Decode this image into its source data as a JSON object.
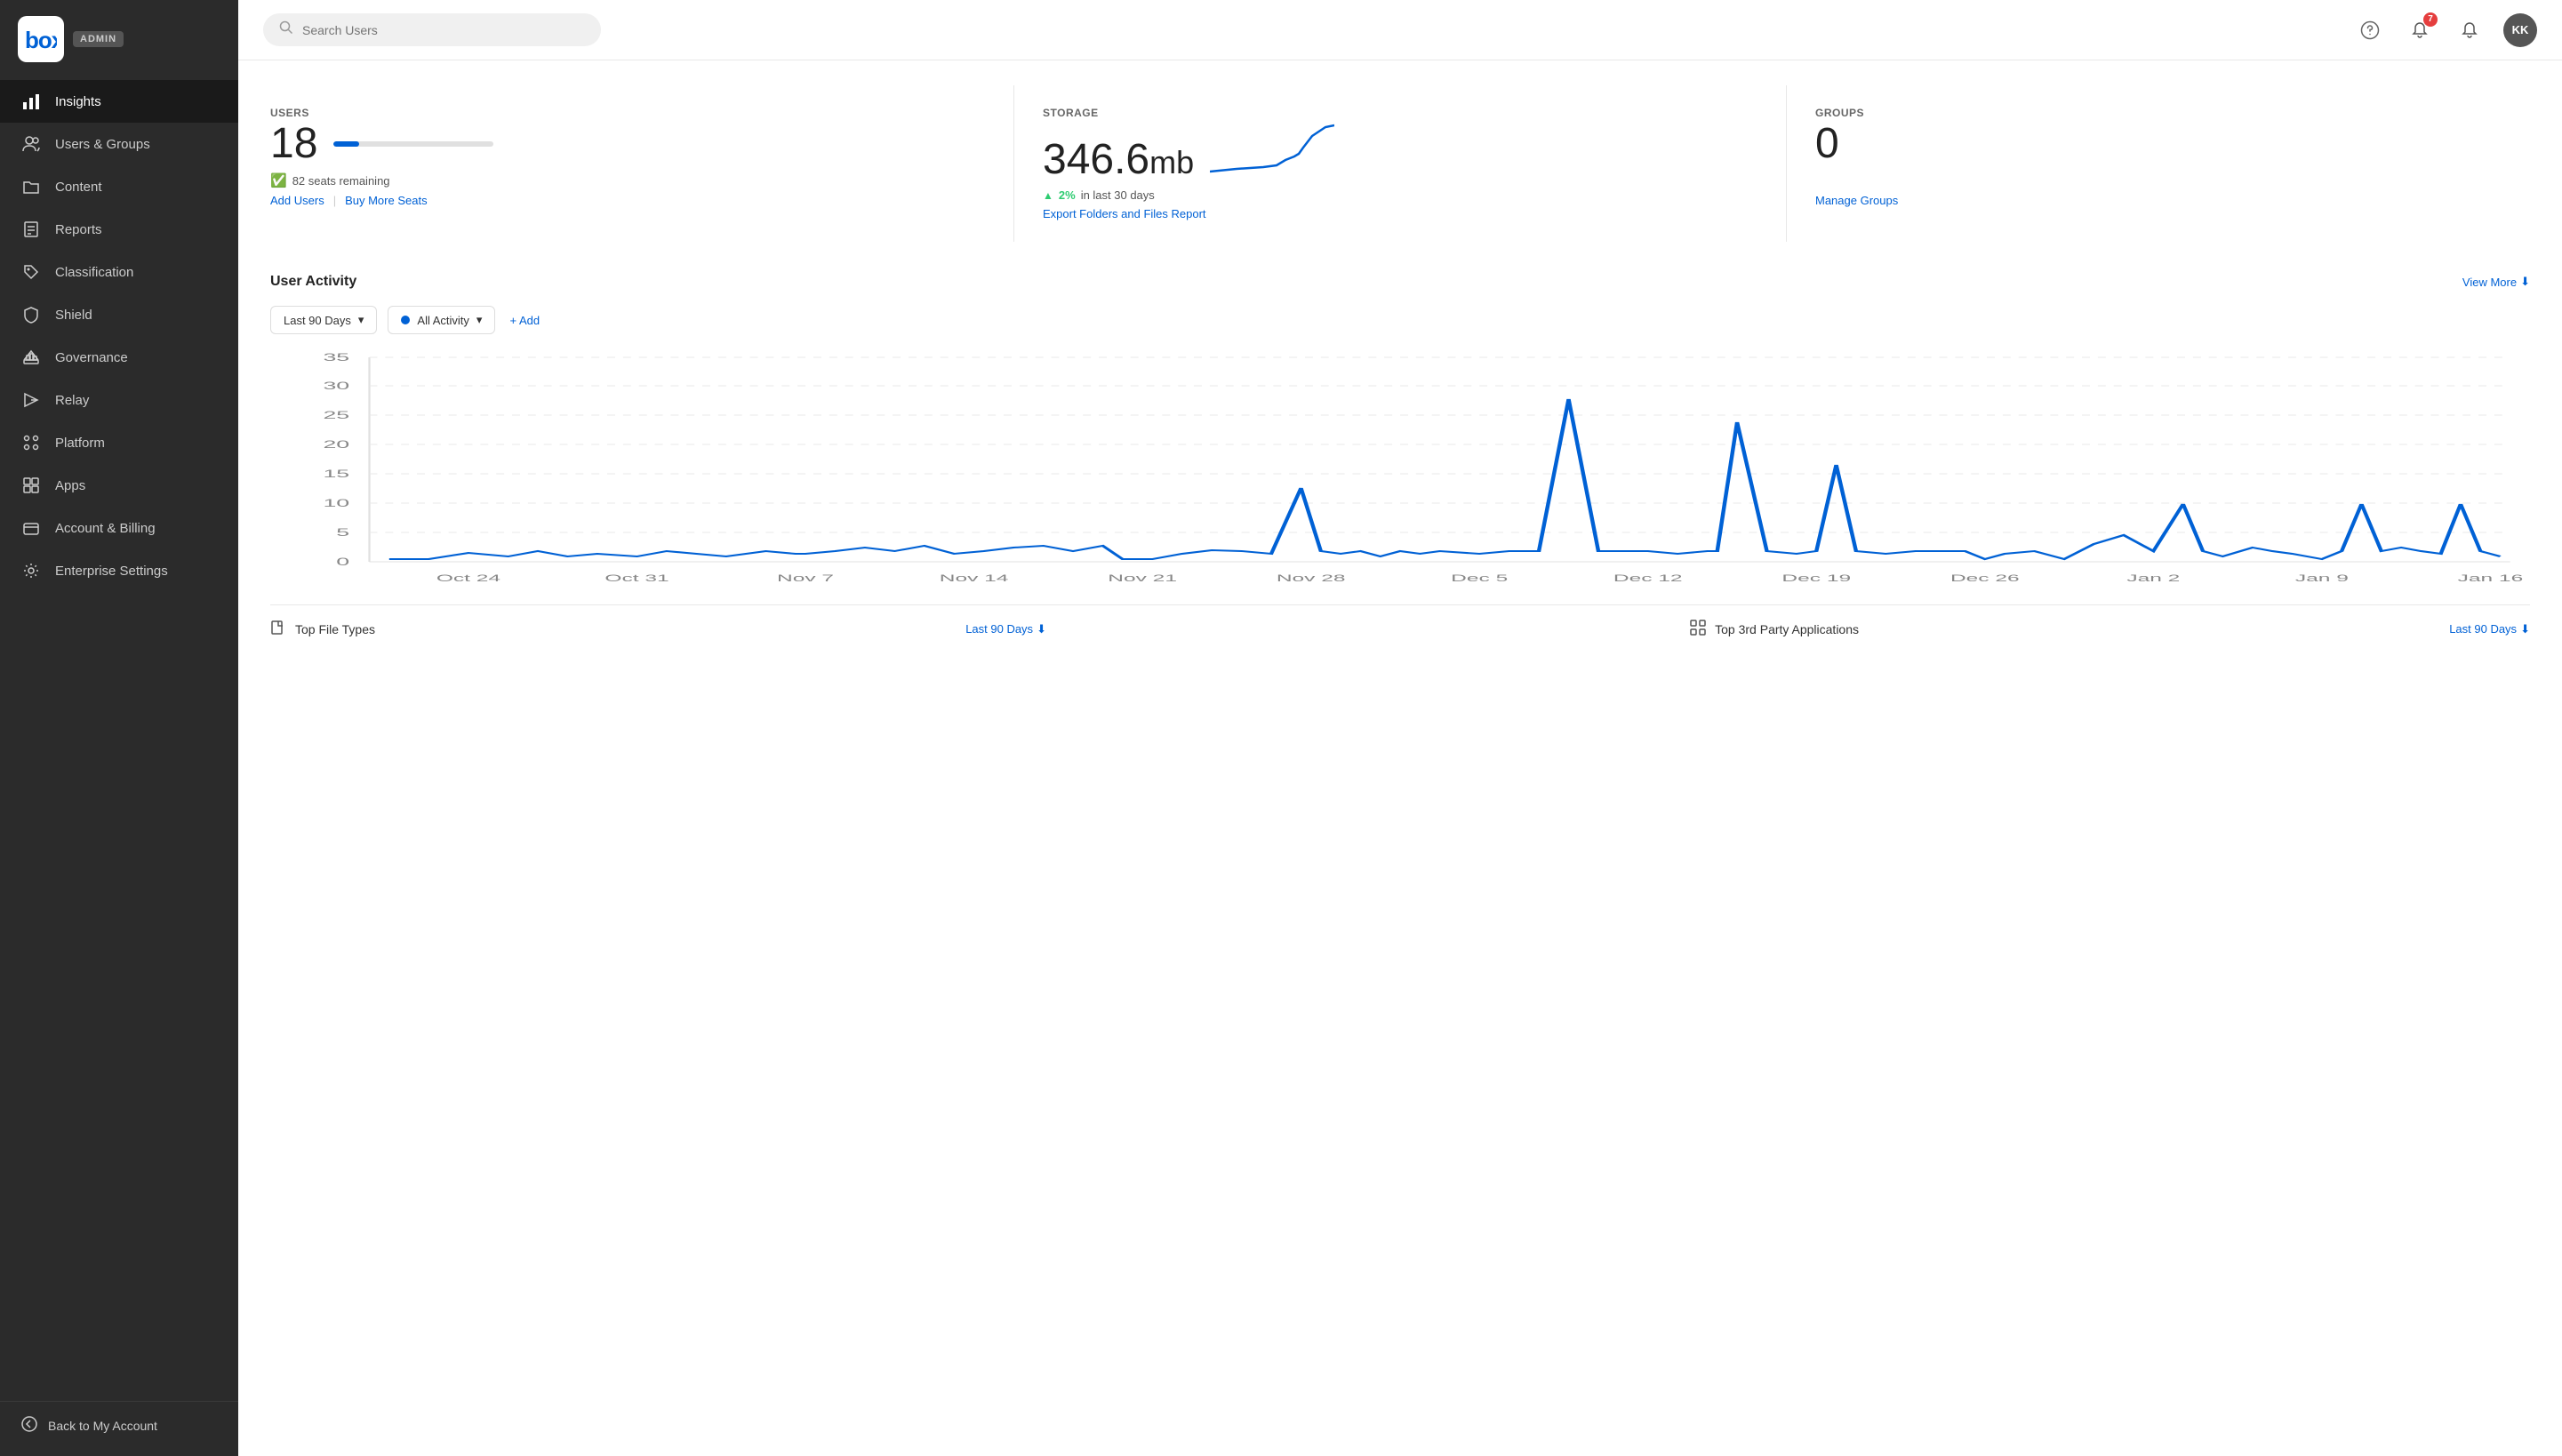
{
  "app": {
    "logo_text": "box",
    "admin_badge": "ADMIN"
  },
  "sidebar": {
    "items": [
      {
        "id": "insights",
        "label": "Insights",
        "icon": "bar-chart-icon",
        "active": true
      },
      {
        "id": "users-groups",
        "label": "Users & Groups",
        "icon": "users-icon",
        "active": false
      },
      {
        "id": "content",
        "label": "Content",
        "icon": "folder-icon",
        "active": false
      },
      {
        "id": "reports",
        "label": "Reports",
        "icon": "report-icon",
        "active": false
      },
      {
        "id": "classification",
        "label": "Classification",
        "icon": "tag-icon",
        "active": false
      },
      {
        "id": "shield",
        "label": "Shield",
        "icon": "shield-icon",
        "active": false
      },
      {
        "id": "governance",
        "label": "Governance",
        "icon": "governance-icon",
        "active": false
      },
      {
        "id": "relay",
        "label": "Relay",
        "icon": "relay-icon",
        "active": false
      },
      {
        "id": "platform",
        "label": "Platform",
        "icon": "platform-icon",
        "active": false
      },
      {
        "id": "apps",
        "label": "Apps",
        "icon": "apps-icon",
        "active": false
      },
      {
        "id": "account-billing",
        "label": "Account & Billing",
        "icon": "billing-icon",
        "active": false
      },
      {
        "id": "enterprise-settings",
        "label": "Enterprise Settings",
        "icon": "settings-icon",
        "active": false
      }
    ],
    "back_label": "Back to My Account"
  },
  "header": {
    "search_placeholder": "Search Users",
    "notification_count": "7",
    "avatar_initials": "KK"
  },
  "stats": {
    "users": {
      "label": "USERS",
      "value": "18",
      "progress_pct": 16,
      "seats_remaining": "82 seats remaining",
      "link1": "Add Users",
      "link2": "Buy More Seats"
    },
    "storage": {
      "label": "STORAGE",
      "value": "346.6",
      "unit": "mb",
      "trend": "2%",
      "trend_label": "in last 30 days",
      "export_link": "Export Folders and Files Report"
    },
    "groups": {
      "label": "GROUPS",
      "value": "0",
      "manage_link": "Manage Groups"
    }
  },
  "activity": {
    "section_title": "User Activity",
    "view_more": "View More",
    "filter_period": "Last 90 Days",
    "filter_activity": "All Activity",
    "add_filter": "+ Add",
    "y_labels": [
      "0",
      "5",
      "10",
      "15",
      "20",
      "25",
      "30",
      "35"
    ],
    "x_labels": [
      "Oct 24",
      "Oct 31",
      "Nov 7",
      "Nov 14",
      "Nov 21",
      "Nov 28",
      "Dec 5",
      "Dec 12",
      "Dec 19",
      "Dec 26",
      "Jan 2",
      "Jan 9",
      "Jan 16"
    ]
  },
  "bottom": {
    "file_types_label": "Top File Types",
    "file_types_period": "Last 90 Days",
    "apps_label": "Top 3rd Party Applications",
    "apps_period": "Last 90 Days"
  }
}
